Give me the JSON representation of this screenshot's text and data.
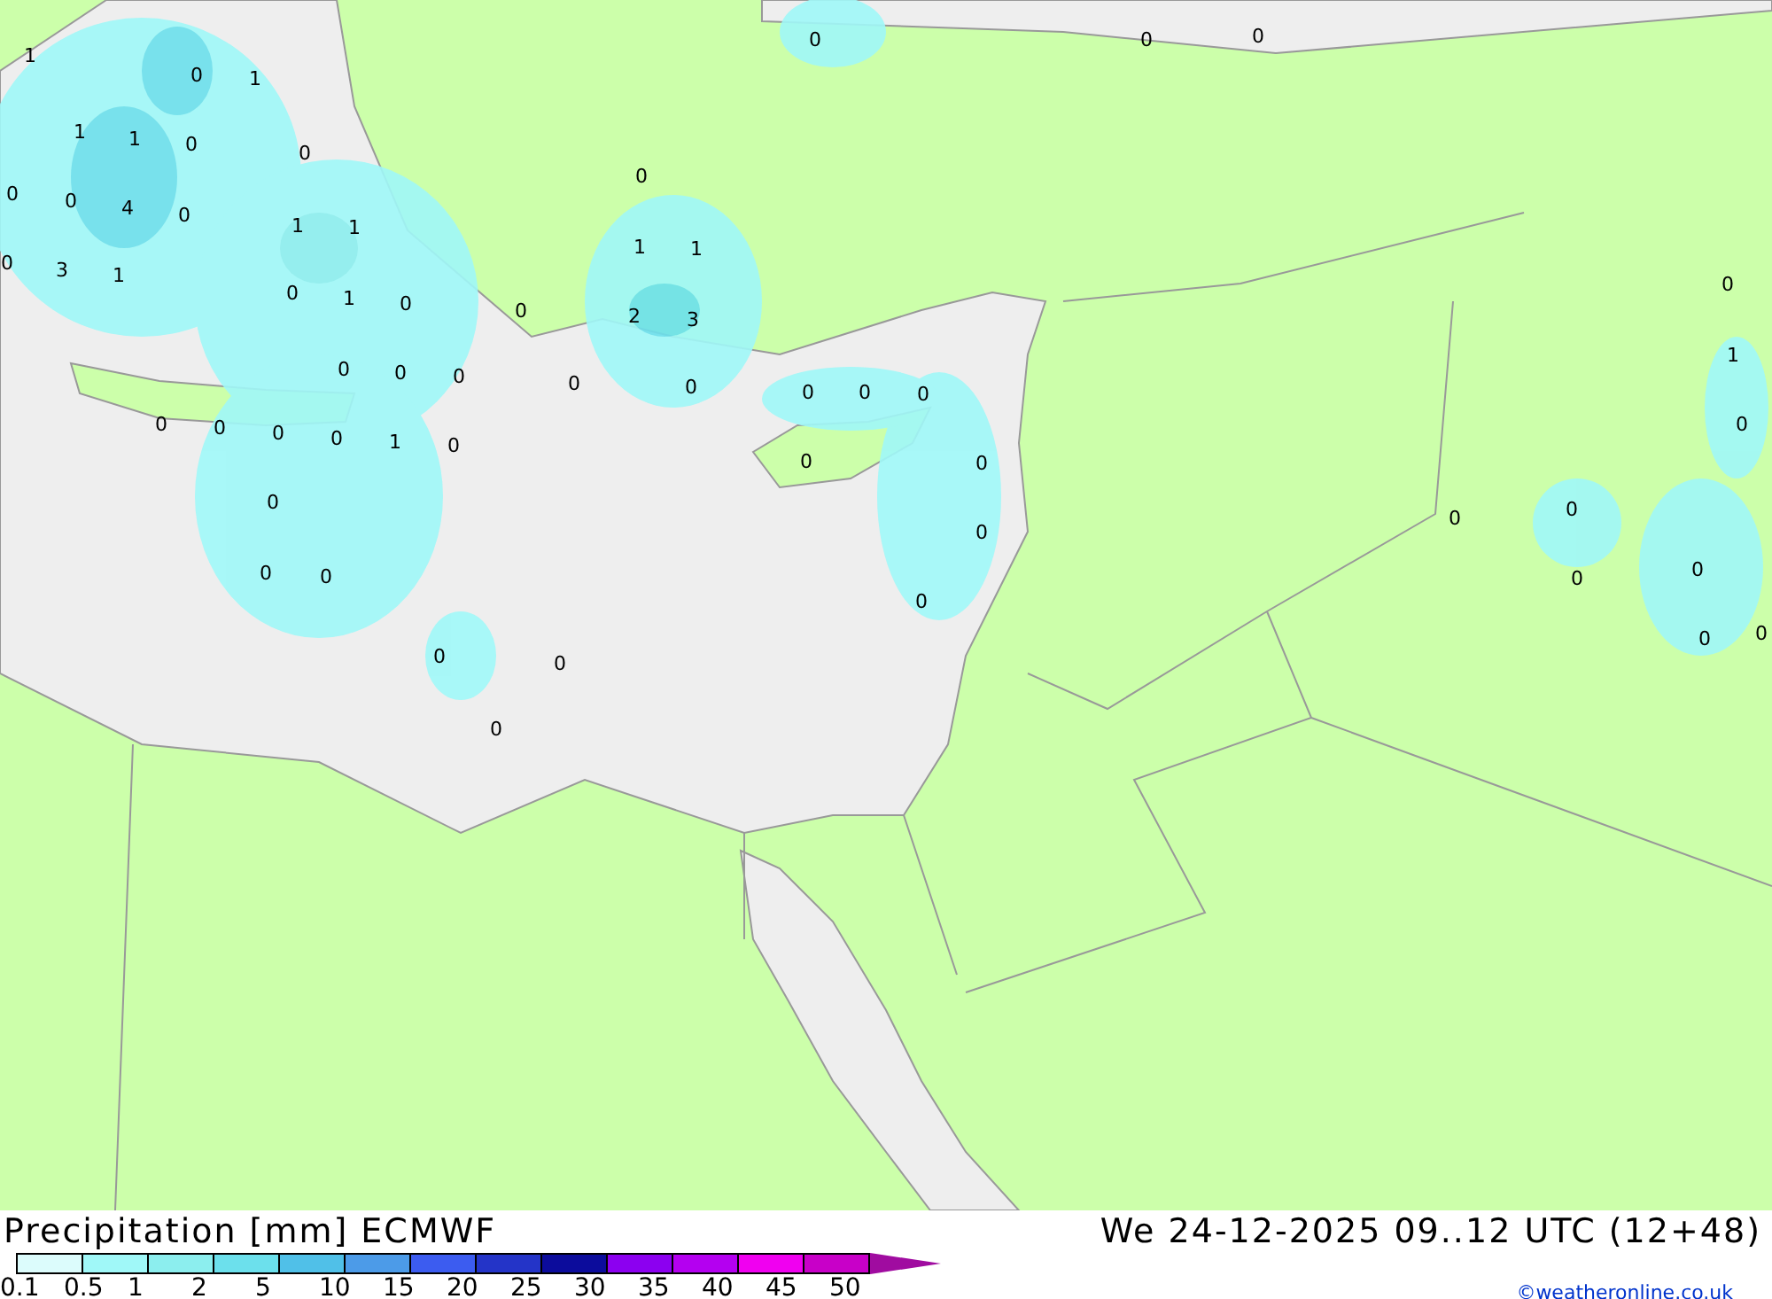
{
  "map": {
    "values": [
      "1",
      "0",
      "1",
      "1",
      "1",
      "0",
      "0",
      "0",
      "4",
      "0",
      "0",
      "3",
      "1",
      "0",
      "1",
      "1",
      "0",
      "1",
      "0",
      "0",
      "0",
      "0",
      "0",
      "0",
      "0",
      "0",
      "0",
      "1",
      "0",
      "0",
      "0",
      "0",
      "0",
      "1",
      "1",
      "2",
      "3",
      "0",
      "0",
      "0",
      "0",
      "0",
      "0",
      "0",
      "0",
      "0",
      "0",
      "0",
      "0",
      "0",
      "0",
      "0",
      "0",
      "1",
      "0",
      "0",
      "0",
      "0",
      "0",
      "0",
      "0"
    ]
  },
  "footer": {
    "title": "Precipitation [mm] ECMWF",
    "valid_time": "We 24-12-2025 09..12 UTC (12+48)",
    "credit": "©weatheronline.co.uk"
  },
  "legend": {
    "steps": [
      {
        "color": "#dcfcfc"
      },
      {
        "color": "#a0f8f8"
      },
      {
        "color": "#8ceeee"
      },
      {
        "color": "#6ce0ec"
      },
      {
        "color": "#50c0e8"
      },
      {
        "color": "#4c9be8"
      },
      {
        "color": "#3c5cf0"
      },
      {
        "color": "#2434c8"
      },
      {
        "color": "#0c0c9c"
      },
      {
        "color": "#8c00f0"
      },
      {
        "color": "#b400f0"
      },
      {
        "color": "#f000f0"
      },
      {
        "color": "#c800c8"
      }
    ],
    "ticks": [
      "0.1",
      "0.5",
      "1",
      "2",
      "5",
      "10",
      "15",
      "20",
      "25",
      "30",
      "35",
      "40",
      "45",
      "50"
    ]
  }
}
